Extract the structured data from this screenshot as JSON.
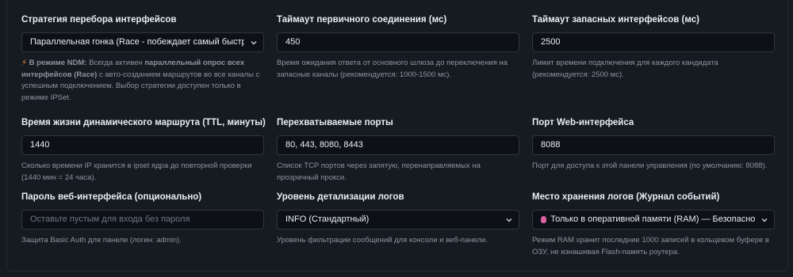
{
  "fields": [
    {
      "label": "Стратегия перебора интерфейсов",
      "value": "Параллельная гонка (Race - побеждает самый быстрый интерфейс)",
      "hint_ndm_prefix": "В режиме NDM:",
      "hint_part1": "Всегда активен",
      "hint_bold": "параллельный опрос всех интерфейсов (Race)",
      "hint_part2": "с авто-созданием маршрутов во все каналы с успешным подключением. Выбор стратегии доступен только в режиме IPSet."
    },
    {
      "label": "Таймаут первичного соединения (мс)",
      "value": "450",
      "hint": "Время ожидания ответа от основного шлюза до переключения на запасные каналы (рекомендуется: 1000-1500 мс)."
    },
    {
      "label": "Таймаут запасных интерфейсов (мс)",
      "value": "2500",
      "hint": "Лимит времени подключения для каждого кандидата (рекомендуется: 2500 мс)."
    },
    {
      "label": "Время жизни динамического маршрута (TTL, минуты)",
      "value": "1440",
      "hint": "Сколько времени IP хранится в ipset ядра до повторной проверки (1440 мин = 24 часа)."
    },
    {
      "label": "Перехватываемые порты",
      "value": "80, 443, 8080, 8443",
      "hint": "Список TCP портов через запятую, перенаправляемых на прозрачный прокси."
    },
    {
      "label": "Порт Web-интерфейса",
      "value": "8088",
      "hint": "Порт для доступа к этой панели управления (по умолчанию: 8088)."
    },
    {
      "label": "Пароль веб-интерфейса (опционально)",
      "placeholder": "Оставьте пустым для входа без пароля",
      "hint": "Защита Basic Auth для панели (логин: admin)."
    },
    {
      "label": "Уровень детализации логов",
      "value": "INFO (Стандартный)",
      "hint": "Уровень фильтрации сообщений для консоли и веб-панели."
    },
    {
      "label": "Место хранения логов (Журнал событий)",
      "value": "Только в оперативной памяти (RAM) — Безопасно для флеш-памяти",
      "hint": "Режим RAM хранит последние 1000 записей в кольцевом буфере в ОЗУ, не изнашивая Flash-память роутера."
    }
  ],
  "icons": {
    "ndm_hint": "lightning-bolt-icon",
    "log_storage": "brain-icon",
    "select": "chevron-down-icon"
  },
  "colors": {
    "background": "#161b22",
    "input_background": "#0d1117",
    "input_border": "#30363d",
    "label": "#e6edf3",
    "hint": "#8b949e",
    "bolt": "#f0883e",
    "brain": "#db61a2"
  }
}
